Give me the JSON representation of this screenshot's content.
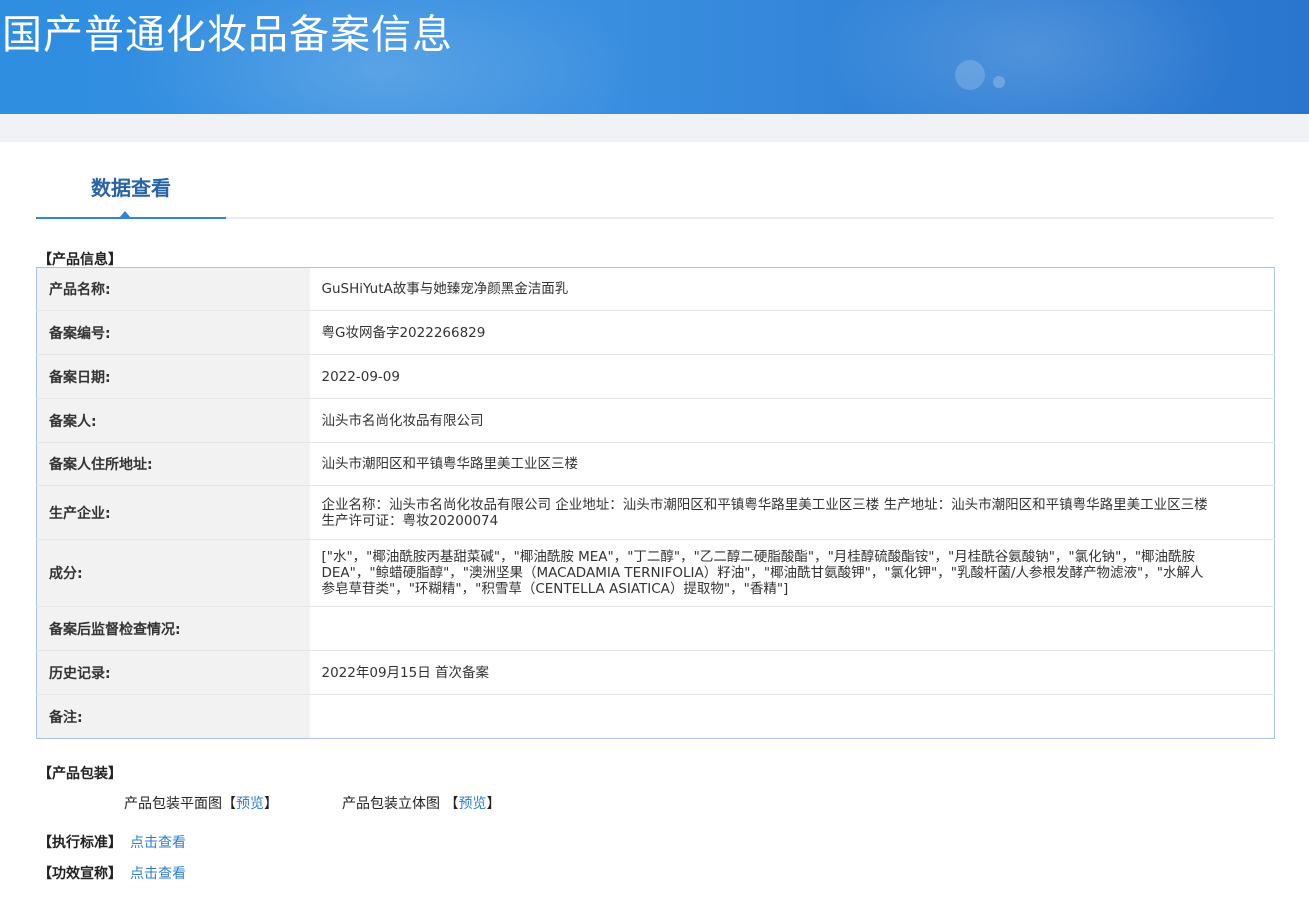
{
  "banner": {
    "title": "国产普通化妆品备案信息"
  },
  "tabs": {
    "active": "数据查看"
  },
  "product_info": {
    "section_title": "【产品信息】",
    "rows": [
      {
        "label": "产品名称:",
        "value": "GuSHiYutA故事与她臻宠净颜黑金洁面乳"
      },
      {
        "label": "备案编号:",
        "value": "粤G妆网备字2022266829"
      },
      {
        "label": "备案日期:",
        "value": "2022-09-09"
      },
      {
        "label": "备案人:",
        "value": "汕头市名尚化妆品有限公司"
      },
      {
        "label": "备案人住所地址:",
        "value": "汕头市潮阳区和平镇粤华路里美工业区三楼"
      },
      {
        "label": "生产企业:",
        "value": "企业名称：汕头市名尚化妆品有限公司 企业地址：汕头市潮阳区和平镇粤华路里美工业区三楼 生产地址：汕头市潮阳区和平镇粤华路里美工业区三楼 生产许可证：粤妆20200074"
      },
      {
        "label": "成分:",
        "value": "[\"水\"，\"椰油酰胺丙基甜菜碱\"，\"椰油酰胺 MEA\"，\"丁二醇\"，\"乙二醇二硬脂酸酯\"，\"月桂醇硫酸酯铵\"，\"月桂酰谷氨酸钠\"，\"氯化钠\"，\"椰油酰胺 DEA\"，\"鲸蜡硬脂醇\"，\"澳洲坚果（MACADAMIA TERNIFOLIA）籽油\"，\"椰油酰甘氨酸钾\"，\"氯化钾\"，\"乳酸杆菌/人参根发酵产物滤液\"，\"水解人参皂草苷类\"，\"环糊精\"，\"积雪草（CENTELLA ASIATICA）提取物\"，\"香精\"]"
      },
      {
        "label": "备案后监督检查情况:",
        "value": ""
      },
      {
        "label": "历史记录:",
        "value": "2022年09月15日 首次备案"
      },
      {
        "label": "备注:",
        "value": ""
      }
    ]
  },
  "packaging": {
    "section_title": "【产品包装】",
    "flat_label": "产品包装平面图",
    "threed_label": "产品包装立体图",
    "bracket_open": "【",
    "bracket_close": "】",
    "preview_label": "预览"
  },
  "standards": {
    "label": "【执行标准】",
    "link": "点击查看"
  },
  "efficacy": {
    "label": "【功效宣称】",
    "link": "点击查看"
  }
}
